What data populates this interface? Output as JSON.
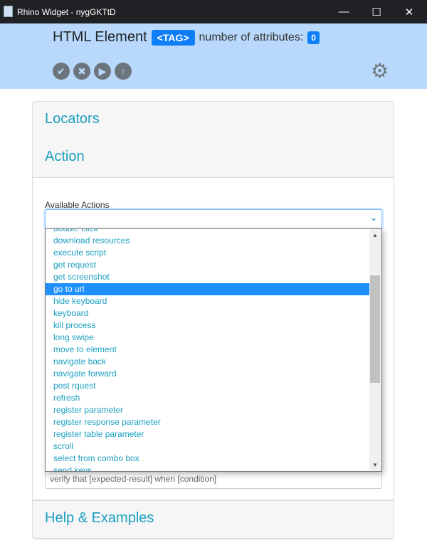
{
  "window": {
    "title": "Rhino Widget - nygGKTtD"
  },
  "header": {
    "title": "HTML Element",
    "tag": "<TAG>",
    "attributes_label": "number of attributes:",
    "attributes_count": "0"
  },
  "sections": {
    "locators": "Locators",
    "action": "Action",
    "help": "Help & Examples"
  },
  "action": {
    "label": "Available Actions",
    "selected": "",
    "input_placeholder": "verify that [expected-result] when [condition]"
  },
  "options": [
    "double click",
    "download resources",
    "execute script",
    "get request",
    "get screenshot",
    "go to url",
    "hide keyboard",
    "keyboard",
    "kill process",
    "long swipe",
    "move to element",
    "navigate back",
    "navigate forward",
    "post rquest",
    "refresh",
    "register parameter",
    "register response parameter",
    "register table parameter",
    "scroll",
    "select from combo box",
    "send keys"
  ],
  "highlighted_option": "go to url"
}
